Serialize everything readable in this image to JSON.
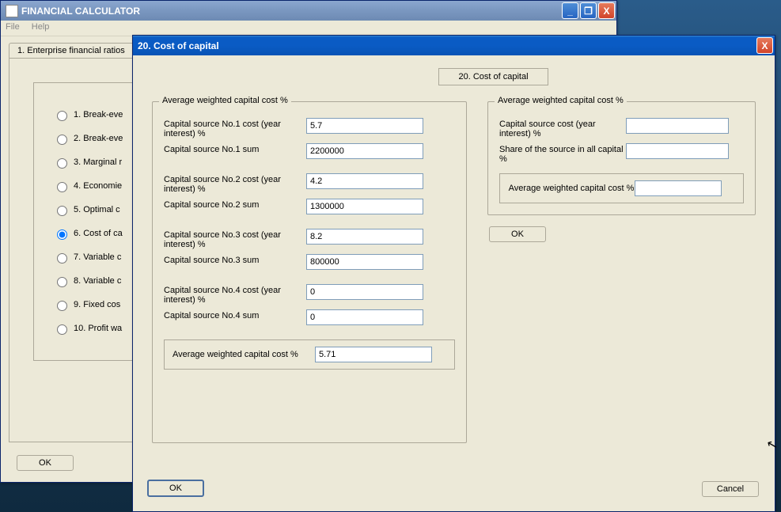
{
  "main_window": {
    "title": "FINANCIAL CALCULATOR",
    "menu": {
      "file": "File",
      "help": "Help"
    },
    "tab_label": "1. Enterprise financial ratios",
    "options": [
      "1. Break-eve",
      "2. Break-eve",
      "3. Marginal r",
      "4. Economie",
      "5. Optimal c",
      "6. Cost of ca",
      "7. Variable c",
      "8. Variable c",
      "9. Fixed cos",
      "10. Profit wa"
    ],
    "selected_index": 5,
    "ok_label": "OK"
  },
  "dialog": {
    "title": "20. Cost of capital",
    "heading": "20. Cost of capital",
    "left_group_label": "Average weighted capital cost %",
    "fields": {
      "c1_cost_label": "Capital source No.1 cost (year interest) %",
      "c1_cost_value": "5.7",
      "c1_sum_label": "Capital source No.1 sum",
      "c1_sum_value": "2200000",
      "c2_cost_label": "Capital source No.2 cost (year interest) %",
      "c2_cost_value": "4.2",
      "c2_sum_label": "Capital source No.2 sum",
      "c2_sum_value": "1300000",
      "c3_cost_label": "Capital source No.3 cost (year interest) %",
      "c3_cost_value": "8.2",
      "c3_sum_label": "Capital source No.3 sum",
      "c3_sum_value": "800000",
      "c4_cost_label": "Capital source No.4 cost (year interest) %",
      "c4_cost_value": "0",
      "c4_sum_label": "Capital source No.4 sum",
      "c4_sum_value": "0"
    },
    "result_label": "Average weighted capital cost %",
    "result_value": "5.71",
    "right_group_label": "Average weighted capital cost %",
    "right": {
      "src_cost_label": "Capital source cost (year interest) %",
      "src_cost_value": "",
      "share_label": "Share of the source in all capital %",
      "share_value": "",
      "out_label": "Average weighted capital cost %",
      "out_value": ""
    },
    "ok_label": "OK",
    "cancel_label": "Cancel"
  },
  "win_controls": {
    "min": "_",
    "max": "❐",
    "close": "X"
  }
}
